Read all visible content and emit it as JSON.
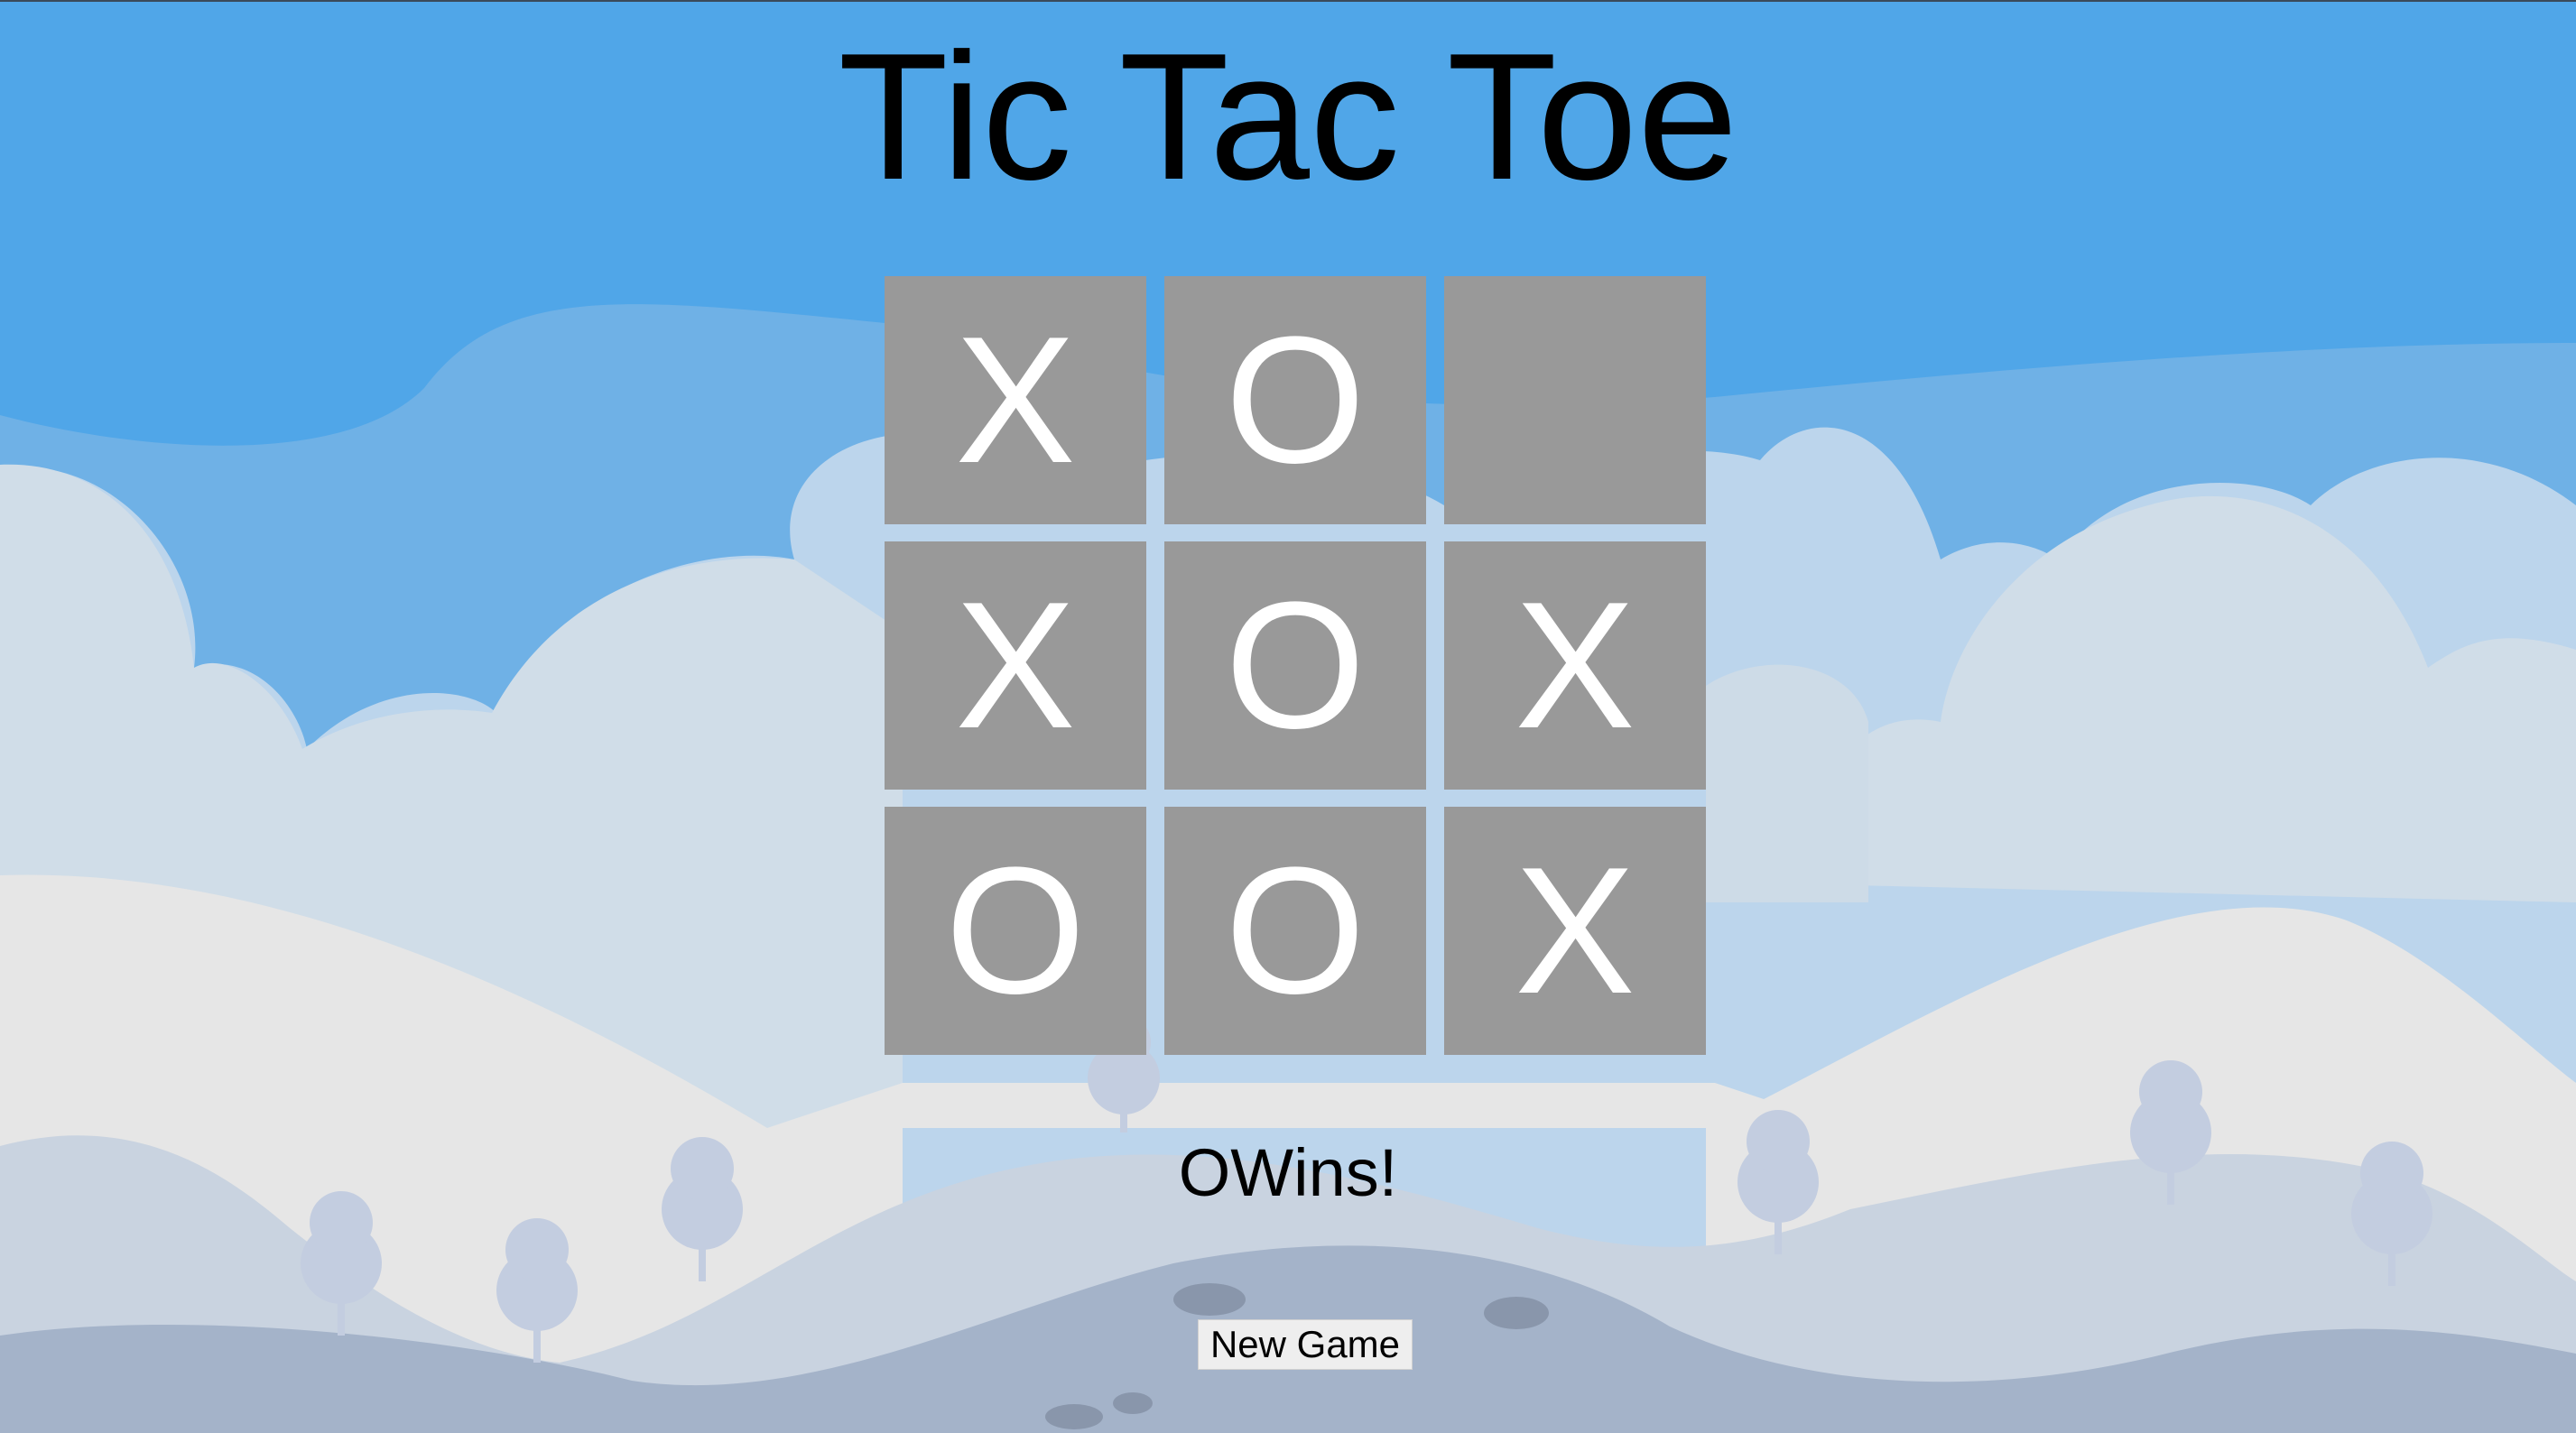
{
  "game": {
    "title": "Tic Tac Toe",
    "board": [
      [
        "X",
        "O",
        ""
      ],
      [
        "X",
        "O",
        "X"
      ],
      [
        "O",
        "O",
        "X"
      ]
    ],
    "status": "OWins!",
    "new_game_label": "New Game"
  },
  "colors": {
    "sky": "#50a6e8",
    "cell_background": "#999999",
    "mark": "#ffffff",
    "button_background": "#eeeeee"
  }
}
